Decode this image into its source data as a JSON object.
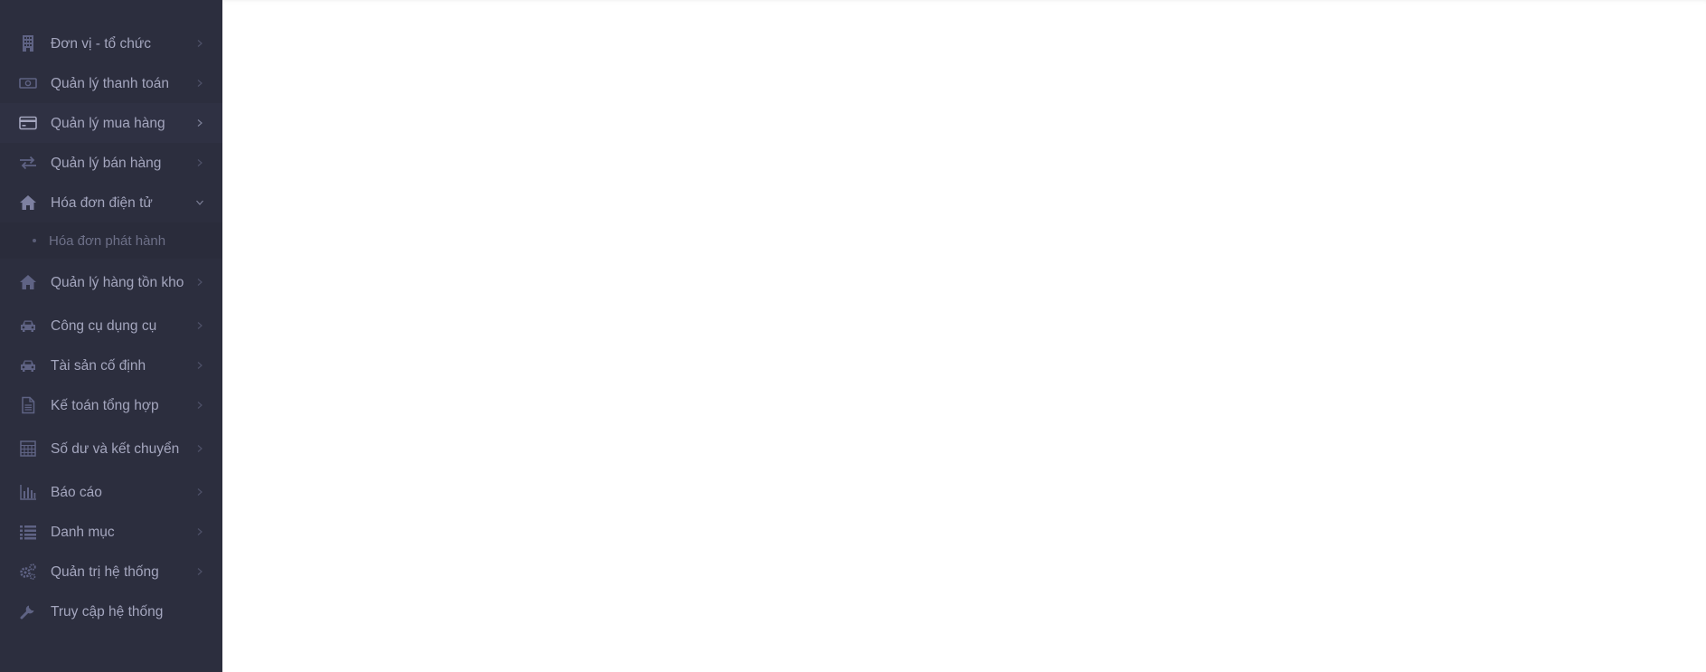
{
  "sidebar": {
    "items": [
      {
        "label": "Đơn vị - tổ chức",
        "icon": "building-icon"
      },
      {
        "label": "Quản lý thanh toán",
        "icon": "money-icon"
      },
      {
        "label": "Quản lý mua hàng",
        "icon": "credit-card-icon"
      },
      {
        "label": "Quản lý bán hàng",
        "icon": "exchange-icon"
      },
      {
        "label": "Hóa đơn điện tử",
        "icon": "home-icon"
      },
      {
        "label": "Quản lý hàng tồn kho",
        "icon": "home-icon"
      },
      {
        "label": "Công cụ dụng cụ",
        "icon": "car-icon"
      },
      {
        "label": "Tài sản cố định",
        "icon": "car-icon"
      },
      {
        "label": "Kế toán tổng hợp",
        "icon": "document-icon"
      },
      {
        "label": "Số dư và kết chuyển",
        "icon": "calculator-icon"
      },
      {
        "label": "Báo cáo",
        "icon": "bar-chart-icon"
      },
      {
        "label": "Danh mục",
        "icon": "list-icon"
      },
      {
        "label": "Quản trị hệ thống",
        "icon": "gears-icon"
      },
      {
        "label": "Truy cập hệ thống",
        "icon": "wrench-icon"
      }
    ],
    "submenu": {
      "items": [
        {
          "label": "Hóa đơn phát hành"
        }
      ]
    }
  },
  "colors": {
    "sidebar_bg": "#2c2e3e",
    "label": "#a4a6be",
    "icon": "#5f6384",
    "content_bg": "#ffffff"
  }
}
